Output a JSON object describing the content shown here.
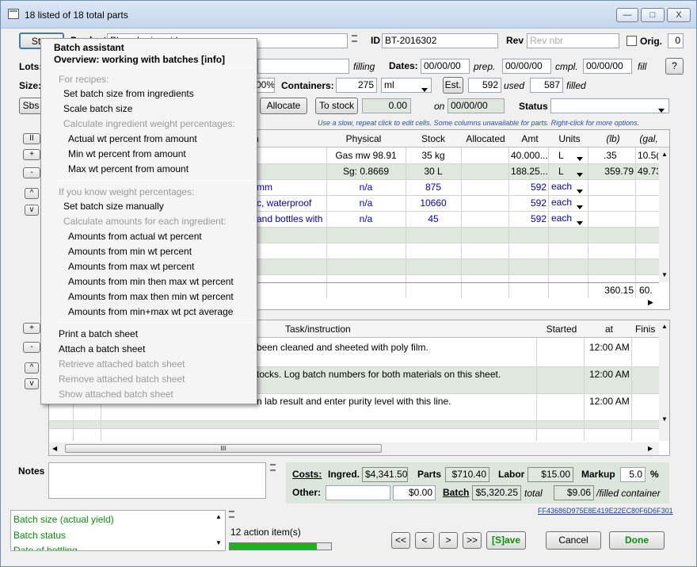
{
  "window": {
    "title": "18 listed of 18 total parts",
    "min": "—",
    "max": "□",
    "close": "X"
  },
  "header": {
    "start_label": "Start",
    "product_label": "Product",
    "product_value": "Phosphoric acid",
    "id_label": "ID",
    "id_value": "BT-2016302",
    "rev_label": "Rev",
    "rev_placeholder": "Rev nbr",
    "orig_label": "Orig.",
    "orig_value": "0"
  },
  "lots": {
    "label": "Lots:",
    "filling_label": "filling",
    "dates_label": "Dates:",
    "prep_value": "00/00/00",
    "prep_label": "prep.",
    "cmpl_value": "00/00/00",
    "cmpl_label": "cmpl.",
    "fill_value": "00/00/00",
    "fill_label": "fill",
    "help_label": "?"
  },
  "size": {
    "label": "Size:",
    "pct_value": "00%",
    "containers_label": "Containers:",
    "containers_value": "275",
    "unit_value": "ml",
    "est_label": "Est.",
    "used_value": "592",
    "used_label": "used",
    "filled_value": "587",
    "filled_label": "filled"
  },
  "actions": {
    "sbs_label": "Sbs",
    "allocate_label": "Allocate",
    "to_stock_label": "To stock",
    "amount_value": "0.00",
    "on_label": "on",
    "on_date": "00/00/00",
    "status_label": "Status",
    "status_value": ""
  },
  "hint": "Use a slow, repeat click to edit cells. Some columns unavailable for parts. Right-click for more options.",
  "side_buttons": {
    "pause": "II",
    "plus": "+",
    "minus": "-",
    "up": "^",
    "down": "v"
  },
  "ingredients": {
    "columns": [
      "n",
      "Physical",
      "Stock",
      "Allocated",
      "Amt",
      "Units",
      "(lb)",
      "(gal,"
    ],
    "rows": [
      {
        "desc": "",
        "physical": "Gas mw 98.91",
        "stock": "35 kg",
        "allocated": "",
        "amt": "40.000...",
        "units": "L",
        "lb": ".35",
        "gal": "10.5("
      },
      {
        "desc": "",
        "physical": "Sg: 0.8669",
        "stock": "30 L",
        "allocated": "",
        "amt": "188.25...",
        "units": "L",
        "lb": "359.79",
        "gal": "49.73"
      },
      {
        "desc": "mm",
        "physical": "n/a",
        "stock": "875",
        "allocated": "",
        "amt": "592",
        "units": "each",
        "lb": "",
        "gal": ""
      },
      {
        "desc": "c, waterproof",
        "physical": "n/a",
        "stock": "10660",
        "allocated": "",
        "amt": "592",
        "units": "each",
        "lb": "",
        "gal": ""
      },
      {
        "desc": "and bottles with",
        "physical": "n/a",
        "stock": "45",
        "allocated": "",
        "amt": "592",
        "units": "each",
        "lb": "",
        "gal": ""
      }
    ],
    "totals": {
      "lb": "360.15",
      "gal": "60."
    }
  },
  "tasks": {
    "columns": [
      "Task/instruction",
      "Started",
      "at",
      "Finis"
    ],
    "rows": [
      {
        "task": "been cleaned and sheeted with poly film.",
        "at": "12:00 AM"
      },
      {
        "task": "tocks. Log batch numbers for both materials on this sheet.",
        "at": "12:00 AM"
      },
      {
        "task": "n lab result and enter purity level with this line.",
        "at": "12:00 AM"
      }
    ],
    "scroll_mark": "III"
  },
  "notes": {
    "label": "Notes"
  },
  "costs": {
    "title": "Costs:",
    "ingred_label": "Ingred.",
    "ingred_value": "$4,341.50",
    "parts_label": "Parts",
    "parts_value": "$710.40",
    "labor_label": "Labor",
    "labor_value": "$15.00",
    "markup_label": "Markup",
    "markup_value": "5.0",
    "markup_unit": "%",
    "other_label": "Other:",
    "other_value": "$0.00",
    "batch_label": "Batch",
    "batch_value": "$5,320.25",
    "total_label": "total",
    "per_value": "$9.06",
    "per_label": "/filled container"
  },
  "hash": "FF43686D975E8E419E22EC80F6D6F301",
  "status_list": [
    "Batch size (actual yield)",
    "Batch status",
    "Date of bottling"
  ],
  "action_items": "12 action item(s)",
  "progress": 0.86,
  "nav": {
    "first": "<<",
    "prev": "<",
    "next": ">",
    "last": ">>",
    "save": "[S]ave",
    "cancel": "Cancel",
    "done": "Done"
  },
  "menu": {
    "items": [
      {
        "label": "Batch assistant",
        "bold": true,
        "disabled": false
      },
      {
        "label": "Overview: working with batches [info]",
        "bold": true,
        "disabled": false
      },
      {
        "label": "For recipes:",
        "disabled": true
      },
      {
        "label": "Set batch size from ingredients",
        "disabled": false
      },
      {
        "label": "Scale batch size",
        "disabled": false
      },
      {
        "label": "Calculate ingredient weight percentages:",
        "disabled": true
      },
      {
        "label": "Actual wt percent from amount",
        "disabled": false
      },
      {
        "label": "Min wt percent from amount",
        "disabled": false
      },
      {
        "label": "Max wt percent from amount",
        "disabled": false
      },
      {
        "label": "If you know weight percentages:",
        "disabled": true
      },
      {
        "label": "Set batch size manually",
        "disabled": false
      },
      {
        "label": "Calculate amounts for each ingredient:",
        "disabled": true
      },
      {
        "label": "Amounts from actual wt percent",
        "disabled": false
      },
      {
        "label": "Amounts from min wt percent",
        "disabled": false
      },
      {
        "label": "Amounts from max wt percent",
        "disabled": false
      },
      {
        "label": "Amounts from min then max wt percent",
        "disabled": false
      },
      {
        "label": "Amounts from max then min wt percent",
        "disabled": false
      },
      {
        "label": "Amounts from min+max wt pct average",
        "disabled": false
      },
      {
        "label": "Print a batch sheet",
        "disabled": false
      },
      {
        "label": "Attach a batch sheet",
        "disabled": false
      },
      {
        "label": "Retrieve attached batch sheet",
        "disabled": true
      },
      {
        "label": "Remove attached batch sheet",
        "disabled": true
      },
      {
        "label": "Show attached batch sheet",
        "disabled": true
      }
    ]
  }
}
